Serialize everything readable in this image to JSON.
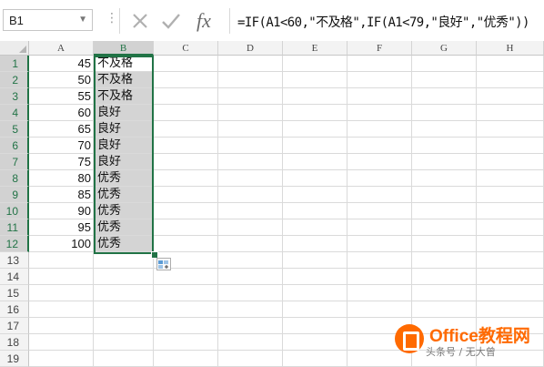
{
  "name_box": {
    "value": "B1"
  },
  "formula_bar": {
    "formula": "=IF(A1<60,\"不及格\",IF(A1<79,\"良好\",\"优秀\"))",
    "insert_function_label": "fx"
  },
  "columns": [
    "A",
    "B",
    "C",
    "D",
    "E",
    "F",
    "G",
    "H"
  ],
  "selected_column": "B",
  "rows": [
    {
      "num": "1",
      "a": "45",
      "b": "不及格"
    },
    {
      "num": "2",
      "a": "50",
      "b": "不及格"
    },
    {
      "num": "3",
      "a": "55",
      "b": "不及格"
    },
    {
      "num": "4",
      "a": "60",
      "b": "良好"
    },
    {
      "num": "5",
      "a": "65",
      "b": "良好"
    },
    {
      "num": "6",
      "a": "70",
      "b": "良好"
    },
    {
      "num": "7",
      "a": "75",
      "b": "良好"
    },
    {
      "num": "8",
      "a": "80",
      "b": "优秀"
    },
    {
      "num": "9",
      "a": "85",
      "b": "优秀"
    },
    {
      "num": "10",
      "a": "90",
      "b": "优秀"
    },
    {
      "num": "11",
      "a": "95",
      "b": "优秀"
    },
    {
      "num": "12",
      "a": "100",
      "b": "优秀"
    },
    {
      "num": "13",
      "a": "",
      "b": ""
    },
    {
      "num": "14",
      "a": "",
      "b": ""
    },
    {
      "num": "15",
      "a": "",
      "b": ""
    },
    {
      "num": "16",
      "a": "",
      "b": ""
    },
    {
      "num": "17",
      "a": "",
      "b": ""
    },
    {
      "num": "18",
      "a": "",
      "b": ""
    },
    {
      "num": "19",
      "a": "",
      "b": ""
    }
  ],
  "colors": {
    "accent": "#217346",
    "selection_fill": "#d4d4d4",
    "watermark": "#ff6a00"
  },
  "watermark": {
    "title": "Office教程网",
    "subtitle": "头条号 / 无大曾"
  }
}
